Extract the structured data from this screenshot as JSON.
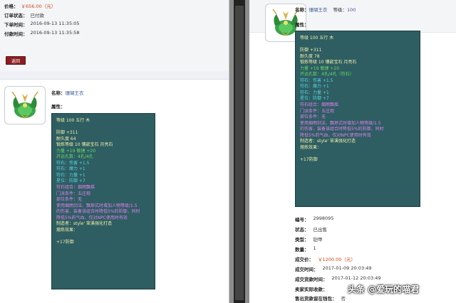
{
  "left": {
    "order_info": [
      {
        "key": "价格：",
        "value": "￥656.00（元）",
        "price": true
      },
      {
        "key": "订单状态：",
        "value": "已付款"
      },
      {
        "key": "下单时间：",
        "value": "2016-09-13 11:35:05"
      },
      {
        "key": "付款时间：",
        "value": "2016-09-13 11:35:58"
      }
    ],
    "button_label": "返回",
    "item": {
      "name_key": "名称：",
      "name_value": "珊瑚王衣",
      "attr_label": "属性："
    }
  },
  "right": {
    "item": {
      "name_key": "名称：",
      "name_value": "珊瑚王衣",
      "level_key": "等级：",
      "level_value": "100",
      "attr_label": "属性："
    },
    "info": [
      {
        "key": "编号：",
        "value": "2998095"
      },
      {
        "key": "状态：",
        "value": "已出售"
      },
      {
        "key": "类型：",
        "value": "铠甲"
      },
      {
        "key": "数量：",
        "value": "1"
      },
      {
        "key": "成交价：",
        "value": "￥1200.00（元）",
        "price": true
      },
      {
        "key": "成交时间：",
        "value": "2017-01-09 20:03:49"
      },
      {
        "key": "成交货款时间：",
        "value": "2017-01-12 20:03:49"
      },
      {
        "key": "卖家实际收款：",
        "value": ""
      },
      {
        "key": "售出货款留在钱包：",
        "value": "否"
      }
    ]
  },
  "left_panel_lines": [
    {
      "text": "等级 100 五行 木",
      "color": "y"
    },
    {
      "text": "",
      "color": "blank"
    },
    {
      "text": "防御 +311",
      "color": "y"
    },
    {
      "text": "耐久度 64",
      "color": "y"
    },
    {
      "text": "锻炼等级 10 镶嵌宝石 月亮石",
      "color": "y"
    },
    {
      "text": "力量 +19 敏捷 +20",
      "color": "g"
    },
    {
      "text": "开运孔数：4孔/4孔",
      "color": "g"
    },
    {
      "text": "符石：伤害 +1.5",
      "color": "c"
    },
    {
      "text": "符石：魔力 +1",
      "color": "c"
    },
    {
      "text": "符石：力量 +1",
      "color": "c"
    },
    {
      "text": "星位：防御 +7",
      "color": "c"
    },
    {
      "text": "符石组合：烟雨飘摇",
      "color": "p"
    },
    {
      "text": "门派条件：五庄观",
      "color": "p"
    },
    {
      "text": "部位条件：无",
      "color": "p"
    },
    {
      "text": "使用烟雨剑法、飘渺式时增加人物等级/1.5",
      "color": "p"
    },
    {
      "text": "的伤害，装备该组合时降低5%的防御，同时",
      "color": "p"
    },
    {
      "text": "降低5%的气血，仅对NPC使用时有效",
      "color": "p"
    },
    {
      "text": "制造者：style' 笨溪强化打造",
      "color": "y"
    },
    {
      "text": "熔炼效果：",
      "color": "y"
    },
    {
      "text": "",
      "color": "blank"
    },
    {
      "text": "+17防御",
      "color": "y"
    }
  ],
  "right_panel_lines": [
    {
      "text": "等级 100 五行 木",
      "color": "y"
    },
    {
      "text": "",
      "color": "blank"
    },
    {
      "text": "防御 +311",
      "color": "y"
    },
    {
      "text": "耐久度 78",
      "color": "y"
    },
    {
      "text": "锻炼等级 10 镶嵌宝石 月亮石",
      "color": "y"
    },
    {
      "text": "力量 +19 敏捷 +20",
      "color": "g"
    },
    {
      "text": "开运孔数：4孔/4孔（符石）",
      "color": "g"
    },
    {
      "text": "符石：伤害 +1.5",
      "color": "c"
    },
    {
      "text": "符石：魔力 +1",
      "color": "c"
    },
    {
      "text": "符石：力量 +1",
      "color": "c"
    },
    {
      "text": "星位：防御 +7",
      "color": "c"
    },
    {
      "text": "符石组合：烟雨飘摇",
      "color": "p"
    },
    {
      "text": "门派条件：五庄观",
      "color": "p"
    },
    {
      "text": "部位条件：无",
      "color": "p"
    },
    {
      "text": "使用烟雨剑法、飘渺式时增加人物等级/1.5",
      "color": "p"
    },
    {
      "text": "的伤害，装备该组合时降低5%的防御，同时",
      "color": "p"
    },
    {
      "text": "降低5%的气血，仅对NPC使用时有效",
      "color": "p"
    },
    {
      "text": "制造者：style' 笨溪强化打造",
      "color": "y"
    },
    {
      "text": "熔炼效果：",
      "color": "y"
    },
    {
      "text": "",
      "color": "blank"
    },
    {
      "text": "+17防御",
      "color": "y"
    }
  ],
  "watermark": "头条 @爱玩的喵君",
  "icons": [
    "armor-item-icon"
  ]
}
